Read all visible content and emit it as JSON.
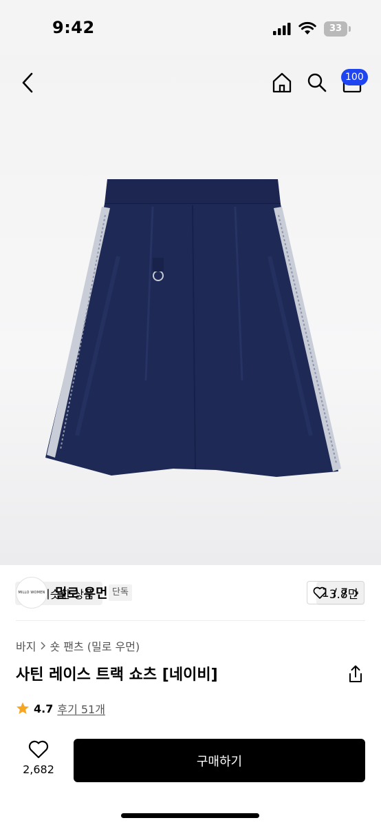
{
  "status_bar": {
    "time": "9:42",
    "battery": "33"
  },
  "nav": {
    "cart_count": "100"
  },
  "gallery": {
    "similar_label": "비슷한 상품",
    "page_indicator": "1 / 7"
  },
  "brand": {
    "logo_text": "MILLO WOMEN",
    "name": "밀로 우먼",
    "tag": "단독",
    "likes": "3.8만"
  },
  "breadcrumb": {
    "category": "바지",
    "subcategory": "숏 팬츠 (밀로 우먼)"
  },
  "product": {
    "title": "사틴 레이스 트랙 쇼츠 [네이비]",
    "rating": "4.7",
    "reviews": "후기 51개"
  },
  "bottom": {
    "wish_count": "2,682",
    "buy_label": "구매하기"
  },
  "colors": {
    "accent": "#1f45f0",
    "product_navy": "#1e2a55",
    "star": "#f6a623"
  }
}
